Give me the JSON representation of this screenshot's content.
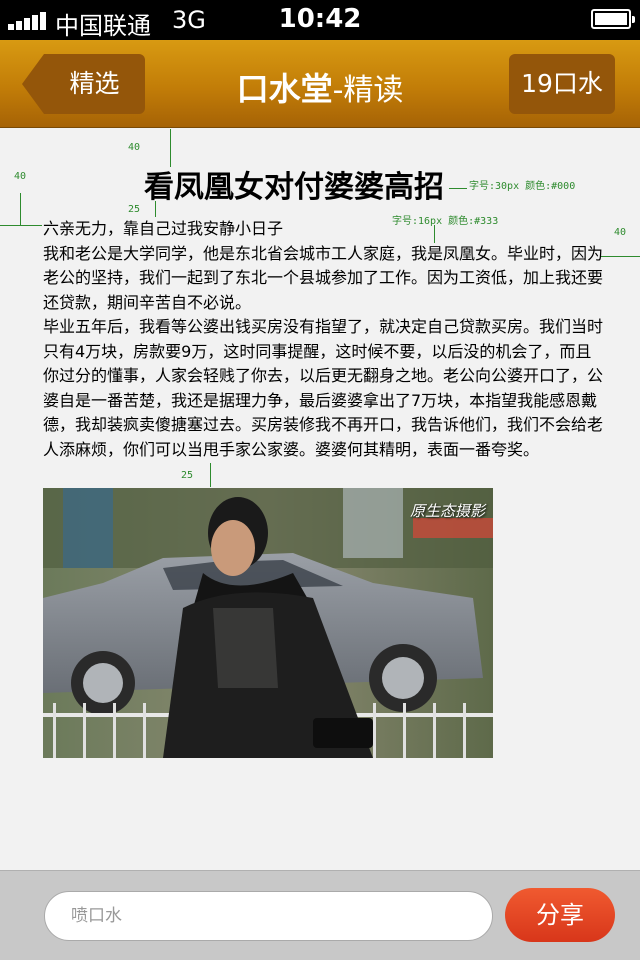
{
  "status_bar": {
    "carrier": "中国联通",
    "network": "3G",
    "time": "10:42"
  },
  "nav": {
    "back_label": "精选",
    "title_brand": "口水堂",
    "title_suffix": "-精读",
    "comments_label": "19口水"
  },
  "article": {
    "title": "看凤凰女对付婆婆高招",
    "paragraphs": [
      "六亲无力，靠自己过我安静小日子",
      "我和老公是大学同学，他是东北省会城市工人家庭，我是凤凰女。毕业时，因为老公的坚持，我们一起到了东北一个县城参加了工作。因为工资低，加上我还要还贷款，期间辛苦自不必说。",
      "毕业五年后，我看等公婆出钱买房没有指望了，就决定自己贷款买房。我们当时只有4万块，房款要9万，这时同事提醒，这时候不要，以后没的机会了，而且你过分的懂事，人家会轻贱了你去，以后更无翻身之地。老公向公婆开口了，公婆自是一番苦楚，我还是据理力争，最后婆婆拿出了7万块，本指望我能感恩戴德，我却装疯卖傻搪塞过去。买房装修我不再开口，我告诉他们，我们不会给老人添麻烦，你们可以当甩手家公家婆。婆婆何其精明，表面一番夸奖。"
    ],
    "photo_watermark": "原生态摄影"
  },
  "annotations": {
    "top_spacing": "40",
    "left_spacing": "40",
    "right_spacing": "40",
    "title_body_gap": "25",
    "body_image_gap": "25",
    "title_spec": "字号:30px 颜色:#000",
    "body_spec": "字号:16px 颜色:#333"
  },
  "bottom_bar": {
    "comment_placeholder": "喷口水",
    "share_label": "分享"
  },
  "colors": {
    "nav_gradient_top": "#d89a12",
    "nav_gradient_bottom": "#a66306",
    "nav_button": "#94560a",
    "share_button": "#e84a26",
    "annotation": "#2e8b2e"
  }
}
